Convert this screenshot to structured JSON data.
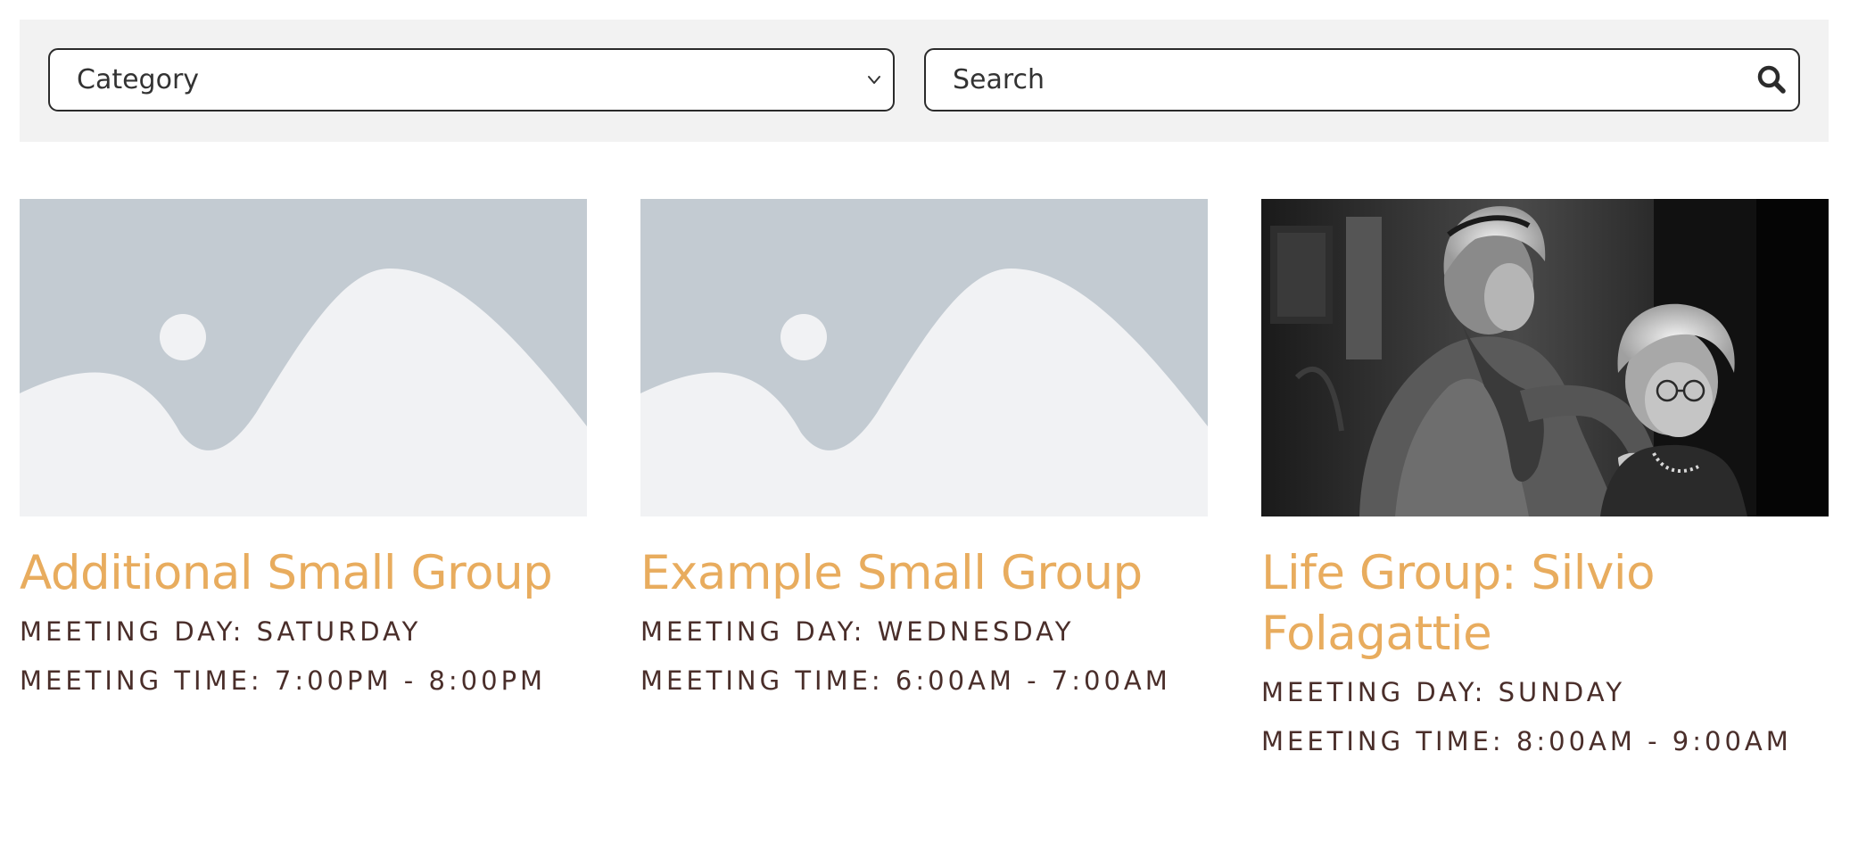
{
  "filters": {
    "category": {
      "selected": "Category"
    },
    "search": {
      "placeholder": "Search"
    }
  },
  "groups": [
    {
      "title": "Additional Small Group",
      "meeting_day": "MEETING DAY: SATURDAY",
      "meeting_time": "MEETING TIME: 7:00PM - 8:00PM",
      "image": "placeholder-image-icon"
    },
    {
      "title": "Example Small Group",
      "meeting_day": "MEETING DAY: WEDNESDAY",
      "meeting_time": "MEETING TIME: 6:00AM - 7:00AM",
      "image": "placeholder-image-icon"
    },
    {
      "title": "Life Group: Silvio Folagattie",
      "meeting_day": "MEETING DAY: SUNDAY",
      "meeting_time": "MEETING TIME: 8:00AM - 9:00AM",
      "image": "black-and-white-photo-of-two-elderly-women"
    }
  ],
  "colors": {
    "title": "#e8ac5e",
    "meta": "#4a2e2a",
    "filter_bar": "#f2f2f2",
    "placeholder_bg": "#c3cbd2",
    "placeholder_fg": "#f1f2f4"
  }
}
